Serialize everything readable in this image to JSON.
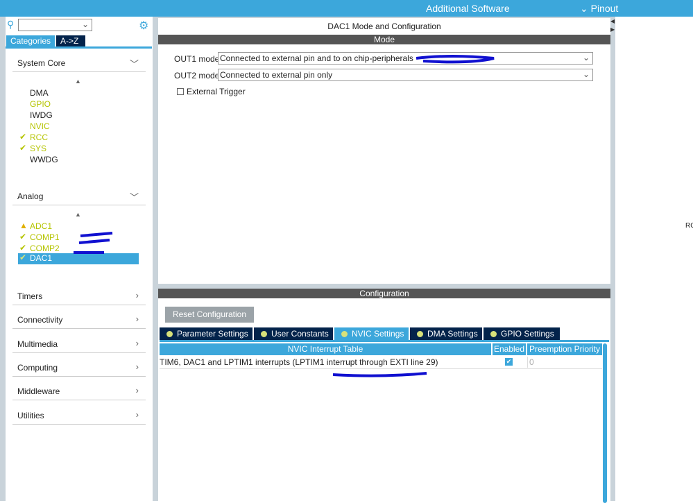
{
  "topbar": {
    "additional_software": "Additional Software",
    "pinout": "Pinout",
    "pinout_icon": "chevron-down-icon"
  },
  "sidebar": {
    "search_value": "",
    "tabs": [
      "Categories",
      "A->Z"
    ],
    "system_core": {
      "label": "System Core",
      "items": [
        {
          "label": "DMA",
          "status": "none"
        },
        {
          "label": "GPIO",
          "status": "none"
        },
        {
          "label": "IWDG",
          "status": "none"
        },
        {
          "label": "NVIC",
          "status": "none"
        },
        {
          "label": "RCC",
          "status": "ok"
        },
        {
          "label": "SYS",
          "status": "ok"
        },
        {
          "label": "WWDG",
          "status": "none"
        }
      ]
    },
    "analog": {
      "label": "Analog",
      "items": [
        {
          "label": "ADC1",
          "status": "warning"
        },
        {
          "label": "COMP1",
          "status": "ok"
        },
        {
          "label": "COMP2",
          "status": "ok"
        },
        {
          "label": "DAC1",
          "status": "ok",
          "selected": true
        }
      ]
    },
    "categories": [
      "Timers",
      "Connectivity",
      "Multimedia",
      "Computing",
      "Middleware",
      "Utilities"
    ]
  },
  "main": {
    "title": "DAC1 Mode and Configuration",
    "mode_header": "Mode",
    "out1_label": "OUT1 mode",
    "out1_value": "Connected to external pin and to on chip-peripherals",
    "out2_label": "OUT2 mode",
    "out2_value": "Connected to external pin only",
    "external_trigger": "External Trigger",
    "external_trigger_checked": false
  },
  "config": {
    "header": "Configuration",
    "reset_button": "Reset Configuration",
    "tabs": [
      "Parameter Settings",
      "User Constants",
      "NVIC Settings",
      "DMA Settings",
      "GPIO Settings"
    ],
    "active_tab": "NVIC Settings",
    "table": {
      "headers": [
        "NVIC Interrupt Table",
        "Enabled",
        "Preemption Priority"
      ],
      "rows": [
        {
          "name": "TIM6, DAC1 and LPTIM1 interrupts (LPTIM1 interrupt through EXTI line 29)",
          "enabled": true,
          "priority": "0"
        }
      ]
    }
  },
  "right_edge_text": "RC",
  "colors": {
    "accent": "#3ca7db",
    "dark_tab": "#03234b",
    "ok": "#b5c400"
  }
}
